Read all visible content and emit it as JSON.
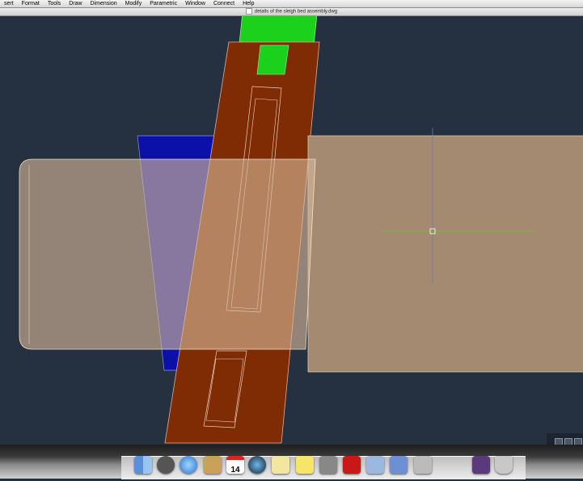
{
  "menubar": {
    "items": [
      "sert",
      "Format",
      "Tools",
      "Draw",
      "Dimension",
      "Modify",
      "Parametric",
      "Window",
      "Connect",
      "Help"
    ]
  },
  "window": {
    "title": "details of the sleigh bed assembly.dwg"
  },
  "canvas": {
    "background": "#253140",
    "colors": {
      "tan_panel": "#a48a70",
      "brown_post": "#7f2c05",
      "green_tenon": "#1bd11b",
      "blue_wedge": "#0a10a8"
    },
    "crosshair": "cursor-crosshair"
  },
  "dock": {
    "icons": [
      "finder-icon",
      "launchpad-icon",
      "safari-icon",
      "address-book-icon",
      "ical-icon",
      "time-machine-icon",
      "textedit-icon",
      "stickies-icon",
      "system-preferences-icon",
      "autocad-icon",
      "preview-icon",
      "mail-icon",
      "calculator-icon",
      "downloads-icon",
      "trash-icon"
    ],
    "ical_day": "14"
  }
}
